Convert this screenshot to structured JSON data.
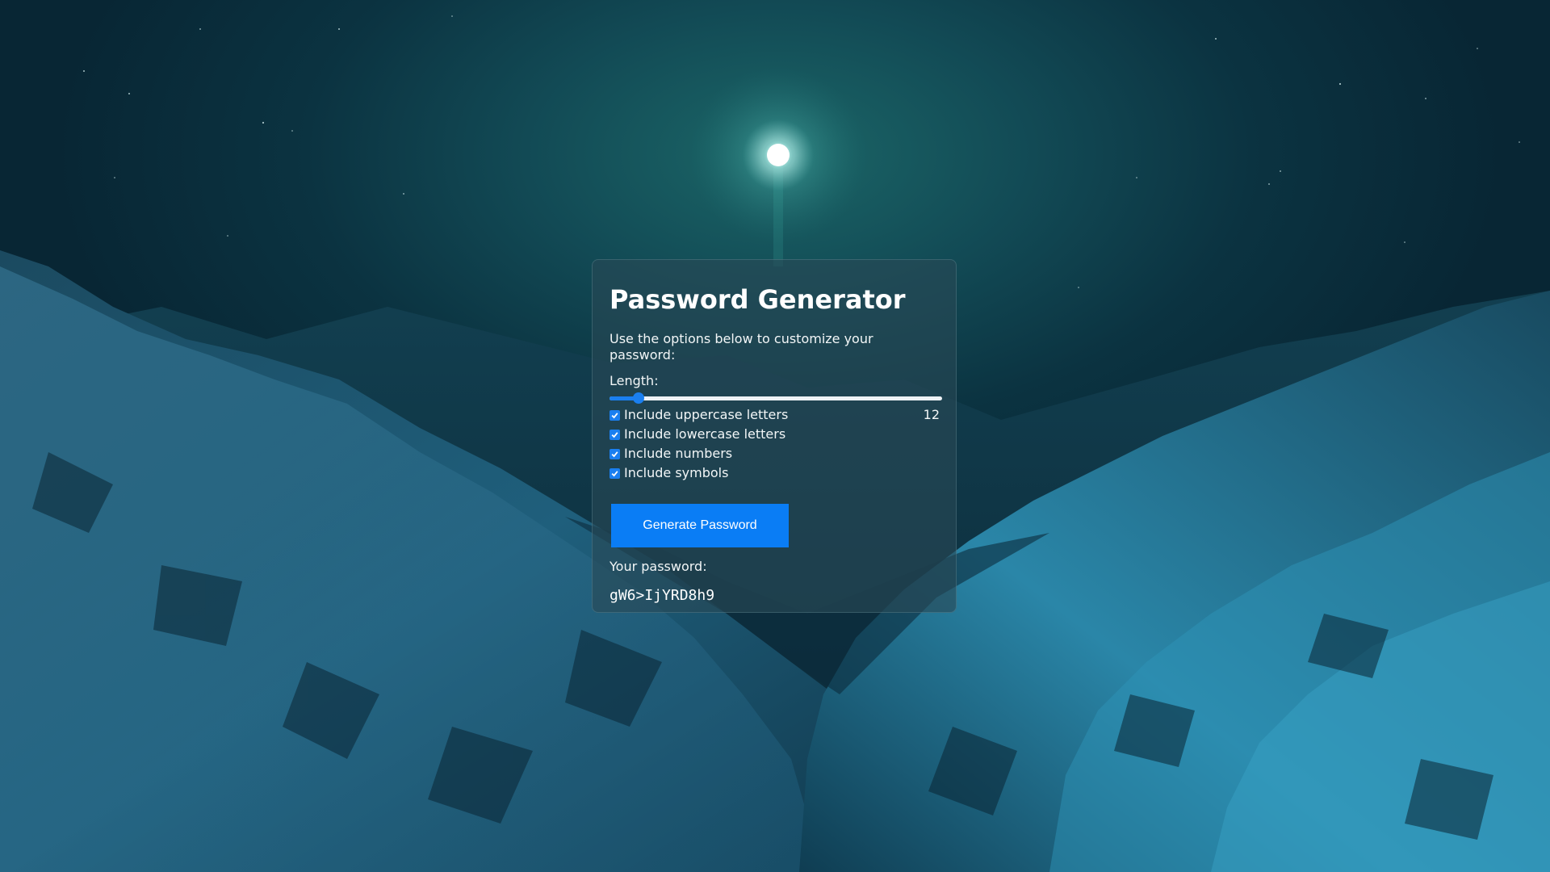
{
  "app": {
    "title": "Password Generator",
    "intro": "Use the options below to customize your password:"
  },
  "length": {
    "label": "Length:",
    "value": "12",
    "min": 8,
    "max": 64,
    "current": 12
  },
  "options": [
    {
      "label": "Include uppercase letters",
      "checked": true
    },
    {
      "label": "Include lowercase letters",
      "checked": true
    },
    {
      "label": "Include numbers",
      "checked": true
    },
    {
      "label": "Include symbols",
      "checked": true
    }
  ],
  "generate_button": {
    "label": "Generate Password"
  },
  "result": {
    "label": "Your password:",
    "password": "gW6>IjYRD8h9"
  },
  "colors": {
    "accent": "#0a7df5",
    "card_text": "#ffffff"
  },
  "icons": {
    "checkbox": "check-icon"
  }
}
